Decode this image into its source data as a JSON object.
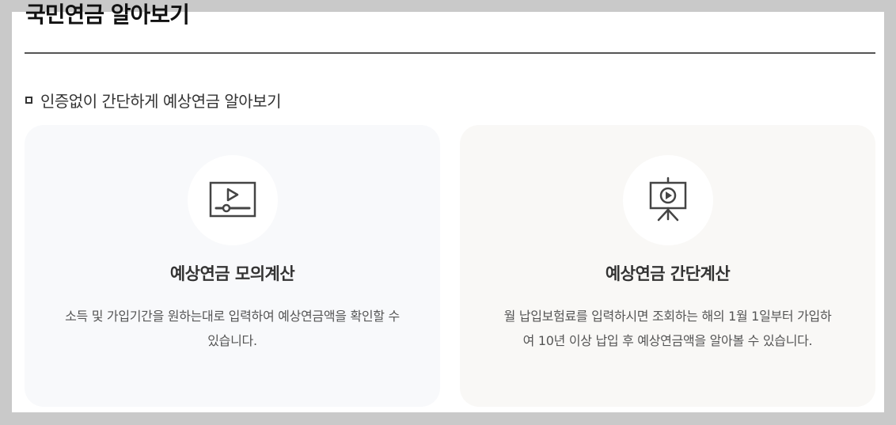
{
  "page": {
    "title": "국민연금 알아보기"
  },
  "section": {
    "heading": "인증없이 간단하게 예상연금 알아보기"
  },
  "cards": [
    {
      "icon": "video-player-icon",
      "title": "예상연금 모의계산",
      "description": "소득 및 가입기간을 원하는대로 입력하여 예상연금액을 확인할 수 있습니다."
    },
    {
      "icon": "presentation-board-icon",
      "title": "예상연금 간단계산",
      "description": "월 납입보험료를 입력하시면 조회하는 해의 1월 1일부터 가입하여 10년 이상 납입 후 예상연금액을 알아볼 수 있습니다."
    }
  ]
}
